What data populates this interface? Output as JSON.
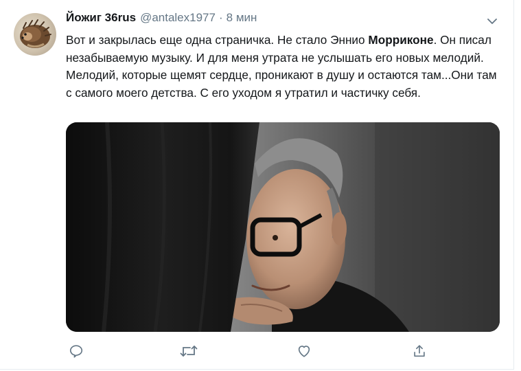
{
  "tweet": {
    "display_name": "Йожиг 36rus",
    "handle": "@antalex1977",
    "separator": "·",
    "timestamp": "8 мин",
    "text_segments": [
      "Вот и закрылась еще одна страничка. Не стало Эннио ",
      "Морриконе",
      ". Он писал незабываемую музыку. И для меня утрата не услышать его новых мелодий. Мелодий, которые щемят сердце, проникают в душу и остаются там...Они там с самого моего детства. С его уходом я утратил и частичку себя."
    ]
  },
  "icons": {
    "caret": "chevron-down-icon",
    "reply": "reply-icon",
    "retweet": "retweet-icon",
    "like": "heart-icon",
    "share": "share-icon"
  },
  "colors": {
    "text": "#14171a",
    "secondary": "#657786",
    "icon": "#657786",
    "border": "#e6ecf0"
  }
}
